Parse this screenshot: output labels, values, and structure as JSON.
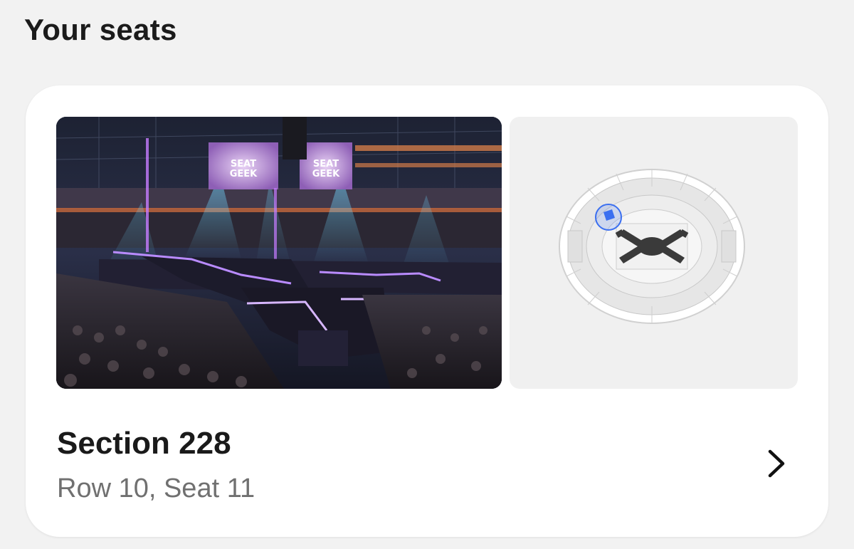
{
  "page": {
    "heading": "Your seats"
  },
  "seat_card": {
    "view_image": {
      "screen_text_1": "SEAT GEEK",
      "screen_text_2": "SEAT GEEK",
      "alt": "view-from-seat-photo"
    },
    "map_icon": "stadium-seat-map-icon",
    "section": "Section 228",
    "seat_detail": "Row 10, Seat 11",
    "chevron_icon": "chevron-right-icon"
  },
  "colors": {
    "background": "#f2f2f2",
    "card": "#ffffff",
    "title_text": "#1a1a1a",
    "secondary_text": "#707070",
    "highlight_section": "#3b6ff0"
  }
}
